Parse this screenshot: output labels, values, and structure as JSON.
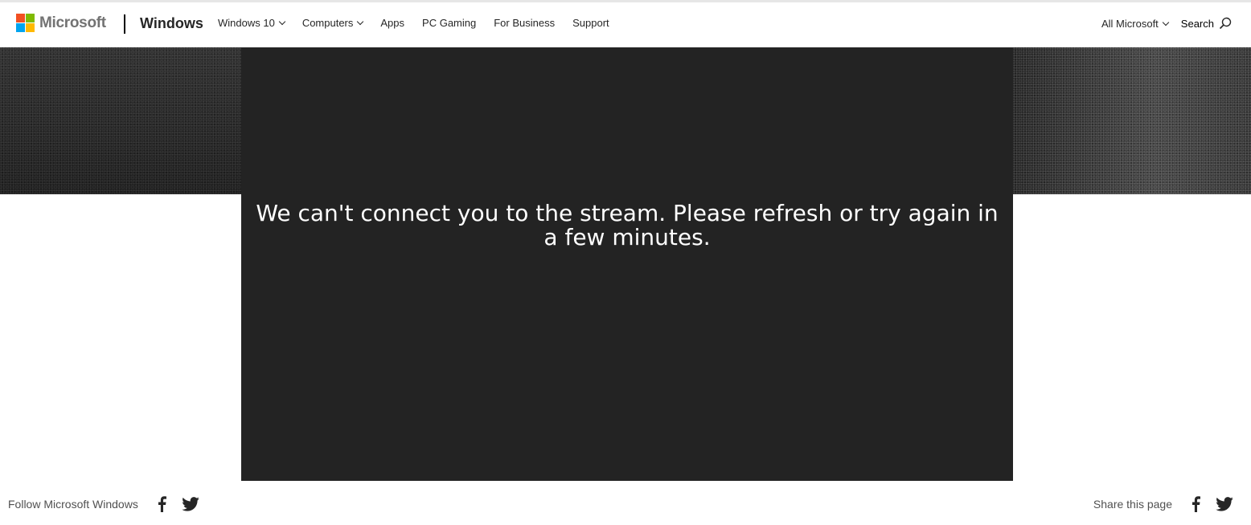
{
  "header": {
    "logo_text": "Microsoft",
    "logo_colors": [
      "#f25022",
      "#7fba00",
      "#00a4ef",
      "#ffb900"
    ],
    "brand": "Windows",
    "nav": [
      {
        "label": "Windows 10",
        "dropdown": true
      },
      {
        "label": "Computers",
        "dropdown": true
      },
      {
        "label": "Apps",
        "dropdown": false
      },
      {
        "label": "PC Gaming",
        "dropdown": false
      },
      {
        "label": "For Business",
        "dropdown": false
      },
      {
        "label": "Support",
        "dropdown": false
      }
    ],
    "all_microsoft": "All Microsoft",
    "search_label": "Search"
  },
  "player": {
    "message": "We can't connect you to the stream. Please refresh or try again in a few minutes.",
    "background": "#232323"
  },
  "footer": {
    "follow_label": "Follow Microsoft Windows",
    "share_label": "Share this page",
    "icons": [
      "facebook-icon",
      "twitter-icon"
    ]
  }
}
